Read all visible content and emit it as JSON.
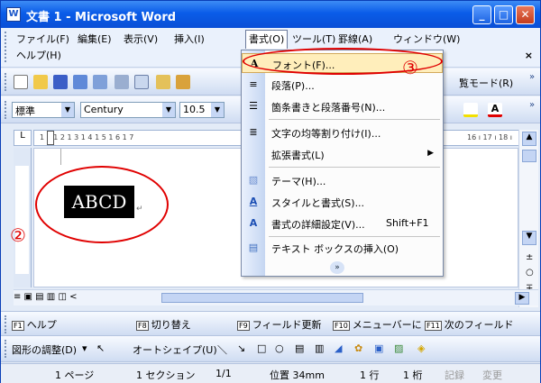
{
  "window": {
    "title": "文書 1 - Microsoft Word",
    "app_icon_label": "W"
  },
  "titlebar_buttons": {
    "minimize": "_",
    "maximize": "□",
    "close": "✕"
  },
  "menubar": {
    "items": [
      "ファイル(F)",
      "編集(E)",
      "表示(V)",
      "挿入(I)",
      "書式(O)",
      "ツール(T)",
      "罫線(A)",
      "ウィンドウ(W)"
    ],
    "help": "ヘルプ(H)",
    "doc_close": "×"
  },
  "toolbar": {
    "reading_mode": "覧モード(R)",
    "style_value": "標準",
    "font_value": "Century",
    "size_value": "10.5",
    "more_buttons": "»"
  },
  "ruler": {
    "ticks": "1  2  1  2  1  3  1  4  1  5  1  6  1  7",
    "right_ticks": "16 ı 17 ı 18 ı"
  },
  "format_menu": {
    "items": [
      {
        "label": "フォント(F)...",
        "icon": "A"
      },
      {
        "label": "段落(P)...",
        "icon": "≡"
      },
      {
        "label": "箇条書きと段落番号(N)...",
        "icon": "☰"
      },
      {
        "label": "文字の均等割り付け(I)...",
        "icon": "≣"
      },
      {
        "label": "拡張書式(L)",
        "icon": ""
      },
      {
        "label": "テーマ(H)...",
        "icon": "▧"
      },
      {
        "label": "スタイルと書式(S)...",
        "icon": "A"
      },
      {
        "label": "書式の詳細設定(V)...",
        "shortcut": "Shift+F1",
        "icon": "A"
      },
      {
        "label": "テキスト ボックスの挿入(O)",
        "icon": "▤"
      }
    ],
    "expand": "»"
  },
  "document": {
    "text": "ABCD",
    "para_mark": "↵"
  },
  "annotations": {
    "num2": "②",
    "num3": "③"
  },
  "view_buttons": "≡ ▣ ▤ ▥ ◫ <",
  "fkeys": [
    {
      "key": "F1",
      "label": "ヘルプ"
    },
    {
      "key": "F8",
      "label": "切り替え"
    },
    {
      "key": "F9",
      "label": "フィールド更新"
    },
    {
      "key": "F10",
      "label": "メニューバーに"
    },
    {
      "key": "F11",
      "label": "次のフィールド"
    }
  ],
  "drawing": {
    "adjust": "図形の調整(D)",
    "autoshape": "オートシェイプ(U)"
  },
  "status": {
    "page": "1 ページ",
    "section": "1 セクション",
    "pages": "1/1",
    "position": "位置 34mm",
    "line": "1 行",
    "column": "1 桁",
    "rec": "記録",
    "trk": "変更"
  }
}
